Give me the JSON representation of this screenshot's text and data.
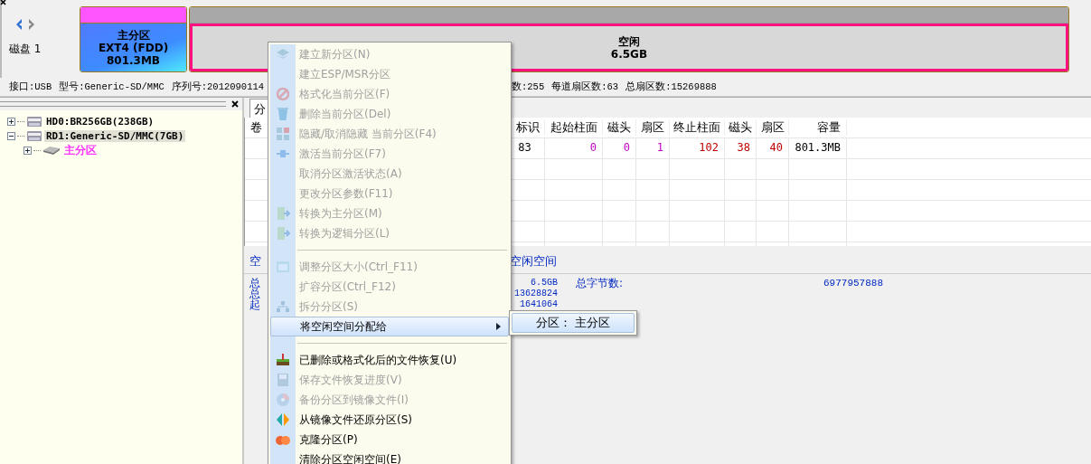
{
  "disk_map": {
    "disk_label": "磁盘 1",
    "partitions": [
      {
        "kind": "partition",
        "name": "主分区",
        "fs": "EXT4 (FDD)",
        "size": "801.3MB",
        "selected": false
      },
      {
        "kind": "free",
        "name": "空闲",
        "size": "6.5GB",
        "selected": true
      }
    ]
  },
  "disk_info": {
    "left": [
      "接口:USB",
      "型号:Generic-SD/MMC",
      "序列号:2012090114"
    ],
    "right": [
      "数:255",
      "每道扇区数:63",
      "总扇区数:15269888"
    ]
  },
  "tree": [
    {
      "label": "HD0:BR256GB(238GB)",
      "expanded": false,
      "selected": false
    },
    {
      "label": "RD1:Generic-SD/MMC(7GB)",
      "expanded": true,
      "selected": true,
      "children": [
        {
          "label": "主分区",
          "expanded": false,
          "selected": false
        }
      ]
    }
  ],
  "tabs": [
    {
      "label": "分",
      "selected": true
    }
  ],
  "table": {
    "first_column": "卷",
    "columns": [
      "标识",
      "起始柱面",
      "磁头",
      "扇区",
      "终止柱面",
      "磁头",
      "扇区",
      "容量"
    ],
    "rows": [
      [
        {
          "text": "83",
          "color": "#000000"
        },
        {
          "text": "0",
          "color": "#c000c0"
        },
        {
          "text": "0",
          "color": "#c000c0"
        },
        {
          "text": "1",
          "color": "#c000c0"
        },
        {
          "text": "102",
          "color": "#c00000"
        },
        {
          "text": "38",
          "color": "#c00000"
        },
        {
          "text": "40",
          "color": "#c00000"
        },
        {
          "text": "801.3MB",
          "color": "#000000"
        }
      ]
    ]
  },
  "details": {
    "heading_left": "空",
    "heading_right": "空闲空间",
    "rows": [
      {
        "label": "总",
        "value": "6.5GB",
        "label2": "总字节数:",
        "value2": "6977957888"
      },
      {
        "label": "总",
        "value": "13628824"
      },
      {
        "label": "起",
        "value": "1641064"
      }
    ]
  },
  "context_menu": {
    "items": [
      {
        "kind": "item",
        "label": "建立新分区(N)",
        "disabled": true,
        "selected": false
      },
      {
        "kind": "item",
        "label": "建立ESP/MSR分区",
        "disabled": true,
        "selected": false
      },
      {
        "kind": "item",
        "label": "格式化当前分区(F)",
        "disabled": true,
        "selected": false
      },
      {
        "kind": "item",
        "label": "删除当前分区(Del)",
        "disabled": true,
        "selected": false
      },
      {
        "kind": "item",
        "label": "隐藏/取消隐藏 当前分区(F4)",
        "disabled": true,
        "selected": false
      },
      {
        "kind": "item",
        "label": "激活当前分区(F7)",
        "disabled": true,
        "selected": false
      },
      {
        "kind": "item",
        "label": "取消分区激活状态(A)",
        "disabled": true,
        "selected": false
      },
      {
        "kind": "item",
        "label": "更改分区参数(F11)",
        "disabled": true,
        "selected": false
      },
      {
        "kind": "item",
        "label": "转换为主分区(M)",
        "disabled": true,
        "selected": false
      },
      {
        "kind": "item",
        "label": "转换为逻辑分区(L)",
        "disabled": true,
        "selected": false
      },
      {
        "kind": "separator"
      },
      {
        "kind": "item",
        "label": "调整分区大小(Ctrl_F11)",
        "disabled": true,
        "selected": false
      },
      {
        "kind": "item",
        "label": "扩容分区(Ctrl_F12)",
        "disabled": true,
        "selected": false
      },
      {
        "kind": "item",
        "label": "拆分分区(S)",
        "disabled": true,
        "selected": false
      },
      {
        "kind": "submenu",
        "label": "将空闲空间分配给",
        "disabled": false,
        "selected": true,
        "items": [
          {
            "label": "分区：  主分区",
            "selected": true
          }
        ]
      },
      {
        "kind": "separator"
      },
      {
        "kind": "item",
        "label": "已删除或格式化后的文件恢复(U)",
        "disabled": false,
        "selected": false
      },
      {
        "kind": "item",
        "label": "保存文件恢复进度(V)",
        "disabled": true,
        "selected": false
      },
      {
        "kind": "item",
        "label": "备份分区到镜像文件(I)",
        "disabled": true,
        "selected": false
      },
      {
        "kind": "item",
        "label": "从镜像文件还原分区(S)",
        "disabled": false,
        "selected": false
      },
      {
        "kind": "item",
        "label": "克隆分区(P)",
        "disabled": false,
        "selected": false
      },
      {
        "kind": "item",
        "label": "清除分区空闲空间(E)",
        "disabled": false,
        "selected": false
      }
    ]
  }
}
